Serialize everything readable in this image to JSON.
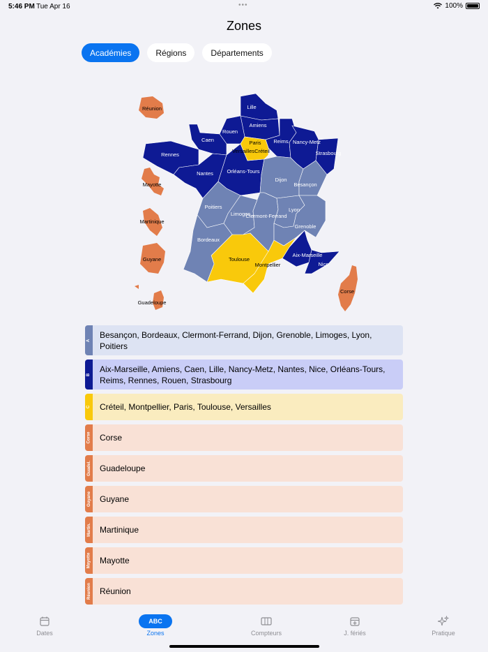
{
  "status": {
    "time": "5:46 PM",
    "date": "Tue Apr 16",
    "battery": "100%"
  },
  "header": {
    "title": "Zones"
  },
  "segments": [
    "Académies",
    "Régions",
    "Départements"
  ],
  "colors": {
    "zone_a": "#6f83b4",
    "zone_b": "#0e1a94",
    "zone_c": "#f9c90b",
    "overseas": "#e27c4a",
    "accent": "#0a74f0"
  },
  "map": {
    "labels": [
      "Lille",
      "Amiens",
      "Rouen",
      "Caen",
      "Rennes",
      "Paris",
      "Versailles",
      "Créteil",
      "Reims",
      "Nancy-Metz",
      "Strasbourg",
      "Nantes",
      "Orléans-Tours",
      "Dijon",
      "Besançon",
      "Poitiers",
      "Limoges",
      "Clermont-Ferrand",
      "Lyon",
      "Grenoble",
      "Bordeaux",
      "Toulouse",
      "Montpellier",
      "Aix-Marseille",
      "Nice",
      "Corse",
      "Réunion",
      "Mayotte",
      "Martinique",
      "Guyane",
      "Guadeloupe"
    ]
  },
  "zones": [
    {
      "tag": "A",
      "text": "Besançon, Bordeaux, Clermont-Ferrand, Dijon, Grenoble, Limoges, Lyon, Poitiers",
      "tag_color": "#6f83b4",
      "bg": "#dde3f3"
    },
    {
      "tag": "B",
      "text": "Aix-Marseille, Amiens, Caen, Lille, Nancy-Metz, Nantes, Nice, Orléans-Tours, Reims, Rennes, Rouen, Strasbourg",
      "tag_color": "#0e1a94",
      "bg": "#c9cdf7"
    },
    {
      "tag": "C",
      "text": "Créteil, Montpellier, Paris, Toulouse, Versailles",
      "tag_color": "#f9c90b",
      "bg": "#faecbf"
    },
    {
      "tag": "Corse",
      "text": "Corse",
      "tag_color": "#e27c4a",
      "bg": "#f9e1d6"
    },
    {
      "tag": "Guadel.",
      "text": "Guadeloupe",
      "tag_color": "#e27c4a",
      "bg": "#f9e1d6"
    },
    {
      "tag": "Guyane",
      "text": "Guyane",
      "tag_color": "#e27c4a",
      "bg": "#f9e1d6"
    },
    {
      "tag": "Martin.",
      "text": "Martinique",
      "tag_color": "#e27c4a",
      "bg": "#f9e1d6"
    },
    {
      "tag": "Mayotte",
      "text": "Mayotte",
      "tag_color": "#e27c4a",
      "bg": "#f9e1d6"
    },
    {
      "tag": "Réunion",
      "text": "Réunion",
      "tag_color": "#e27c4a",
      "bg": "#f9e1d6"
    }
  ],
  "tabbar": {
    "dates": "Dates",
    "zones_icon": "ABC",
    "zones": "Zones",
    "compteurs": "Compteurs",
    "feries": "J. fériés",
    "pratique": "Pratique"
  }
}
